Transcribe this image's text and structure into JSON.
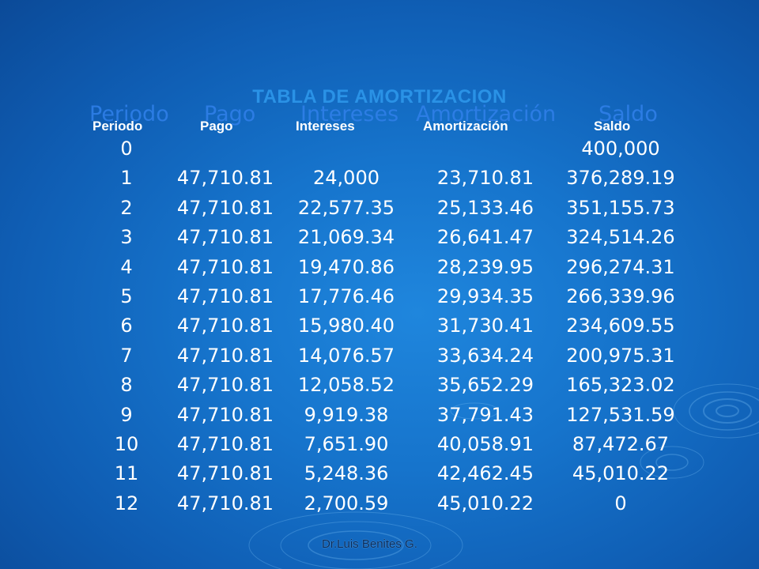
{
  "slide": {
    "title": "TABLA DE AMORTIZACION",
    "ghost_headers": [
      "Periodo",
      "Pago",
      "Intereses",
      "Amortización",
      "Saldo"
    ],
    "headers": [
      "Periodo",
      "Pago",
      "Intereses",
      "Amortización",
      "Saldo"
    ],
    "rows": [
      [
        "0",
        "",
        "",
        "",
        "400,000"
      ],
      [
        "1",
        "47,710.81",
        "24,000",
        "23,710.81",
        "376,289.19"
      ],
      [
        "2",
        "47,710.81",
        "22,577.35",
        "25,133.46",
        "351,155.73"
      ],
      [
        "3",
        "47,710.81",
        "21,069.34",
        "26,641.47",
        "324,514.26"
      ],
      [
        "4",
        "47,710.81",
        "19,470.86",
        "28,239.95",
        "296,274.31"
      ],
      [
        "5",
        "47,710.81",
        "17,776.46",
        "29,934.35",
        "266,339.96"
      ],
      [
        "6",
        "47,710.81",
        "15,980.40",
        "31,730.41",
        "234,609.55"
      ],
      [
        "7",
        "47,710.81",
        "14,076.57",
        "33,634.24",
        "200,975.31"
      ],
      [
        "8",
        "47,710.81",
        "12,058.52",
        "35,652.29",
        "165,323.02"
      ],
      [
        "9",
        "47,710.81",
        "9,919.38",
        "37,791.43",
        "127,531.59"
      ],
      [
        "10",
        "47,710.81",
        "7,651.90",
        "40,058.91",
        "87,472.67"
      ],
      [
        "11",
        "47,710.81",
        "5,248.36",
        "42,462.45",
        "45,010.22"
      ],
      [
        "12",
        "47,710.81",
        "2,700.59",
        "45,010.22",
        "0"
      ]
    ],
    "footer": "Dr.Luis Benites G."
  },
  "colors": {
    "background": "#1674cc",
    "title": "#2a92e6",
    "ghost_header": "#2f7fe8",
    "text": "#ffffff",
    "footer": "#0a2c5a"
  }
}
